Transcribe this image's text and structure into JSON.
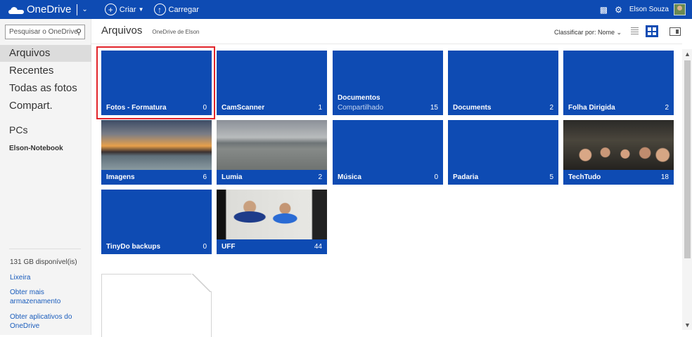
{
  "topbar": {
    "brand": "OneDrive",
    "create": "Criar",
    "upload": "Carregar",
    "user": "Elson Souza",
    "create_icon": "plus-circle",
    "upload_icon": "upload-circle"
  },
  "sidebar": {
    "search_placeholder": "Pesquisar o OneDrive",
    "nav": [
      "Arquivos",
      "Recentes",
      "Todas as fotos",
      "Compart."
    ],
    "pcs": "PCs",
    "pc_name": "Elson-Notebook",
    "storage": "131 GB disponível(is)",
    "trash": "Lixeira",
    "more_storage": "Obter mais armazenamento",
    "get_apps": "Obter aplicativos do OneDrive"
  },
  "header": {
    "title": "Arquivos",
    "subtitle": "OneDrive de Elson",
    "sort": "Classificar por: Nome"
  },
  "tiles": [
    {
      "name": "Fotos - Formatura",
      "count": "0"
    },
    {
      "name": "CamScanner",
      "count": "1"
    },
    {
      "name": "Documentos",
      "sub": "Compartilhado",
      "count": "15"
    },
    {
      "name": "Documents",
      "count": "2"
    },
    {
      "name": "Folha Dirigida",
      "count": "2"
    },
    {
      "name": "Imagens",
      "count": "6"
    },
    {
      "name": "Lumia",
      "count": "2"
    },
    {
      "name": "Música",
      "count": "0"
    },
    {
      "name": "Padaria",
      "count": "5"
    },
    {
      "name": "TechTudo",
      "count": "18"
    },
    {
      "name": "TinyDo backups",
      "count": "0"
    },
    {
      "name": "UFF",
      "count": "44"
    }
  ],
  "colors": {
    "brand": "#0e4bb3",
    "highlight": "#e2242a"
  }
}
